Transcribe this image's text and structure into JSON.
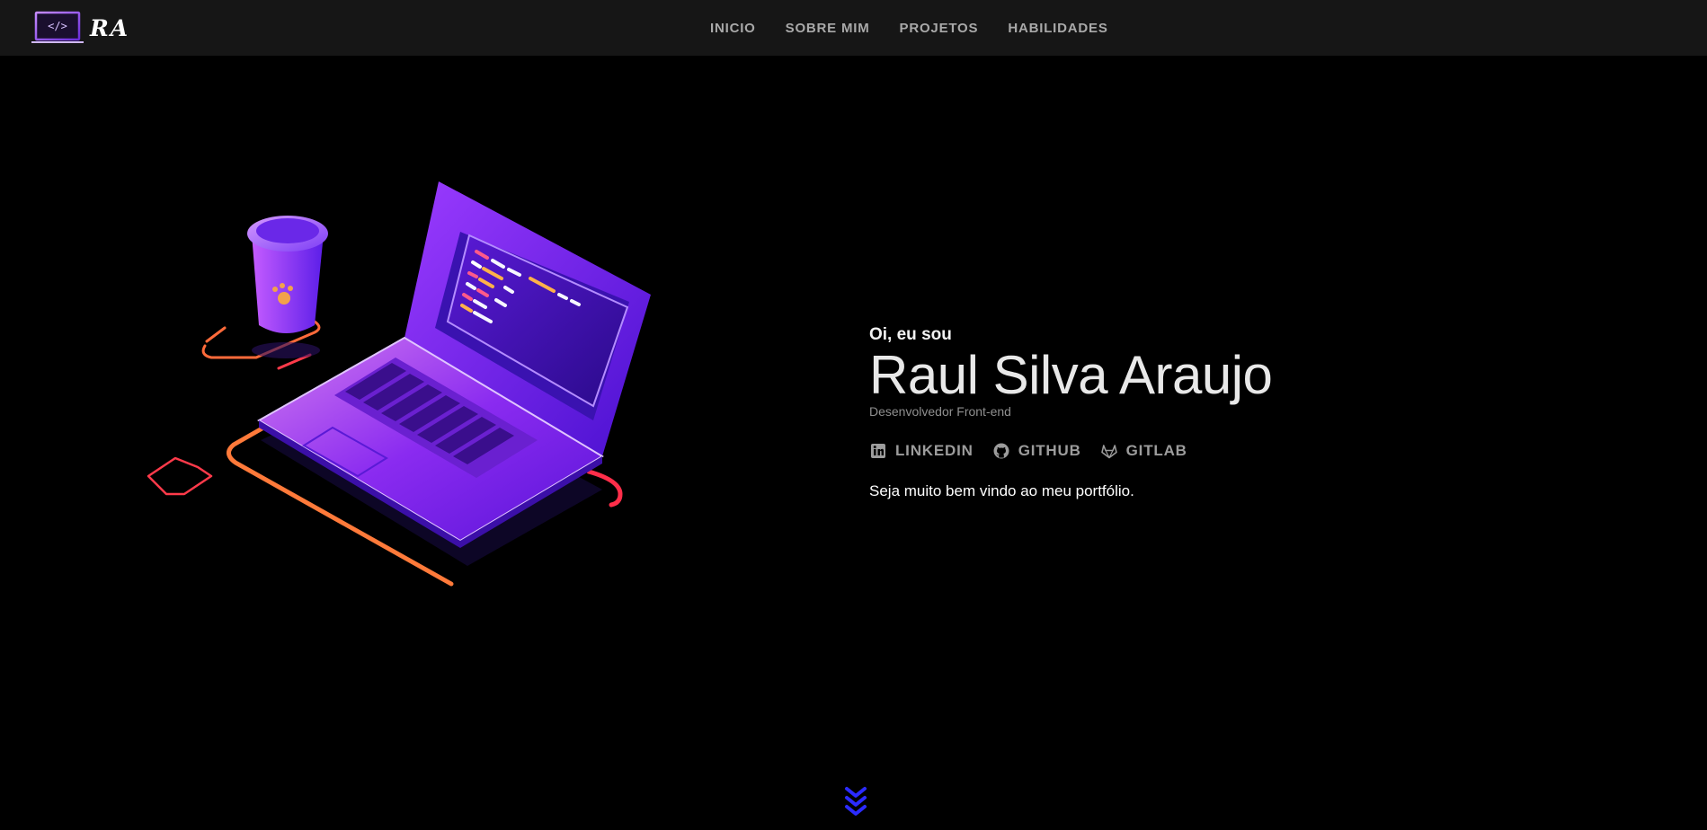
{
  "brand": {
    "logo_mark": "</>",
    "logo_text": "RA",
    "accent": "#8a3ffc"
  },
  "nav": {
    "items": [
      {
        "label": "INICIO"
      },
      {
        "label": "SOBRE MIM"
      },
      {
        "label": "PROJETOS"
      },
      {
        "label": "HABILIDADES"
      }
    ]
  },
  "hero": {
    "greeting": "Oi, eu sou",
    "name": "Raul Silva Araujo",
    "role": "Desenvolvedor Front-end",
    "welcome": "Seja muito bem vindo ao meu portfólio."
  },
  "social": [
    {
      "label": "LINKEDIN",
      "icon": "linkedin-icon"
    },
    {
      "label": "GITHUB",
      "icon": "github-icon"
    },
    {
      "label": "GITLAB",
      "icon": "gitlab-icon"
    }
  ],
  "scroll": {
    "icon": "chevrons-down-icon",
    "color": "#2b2bff"
  }
}
